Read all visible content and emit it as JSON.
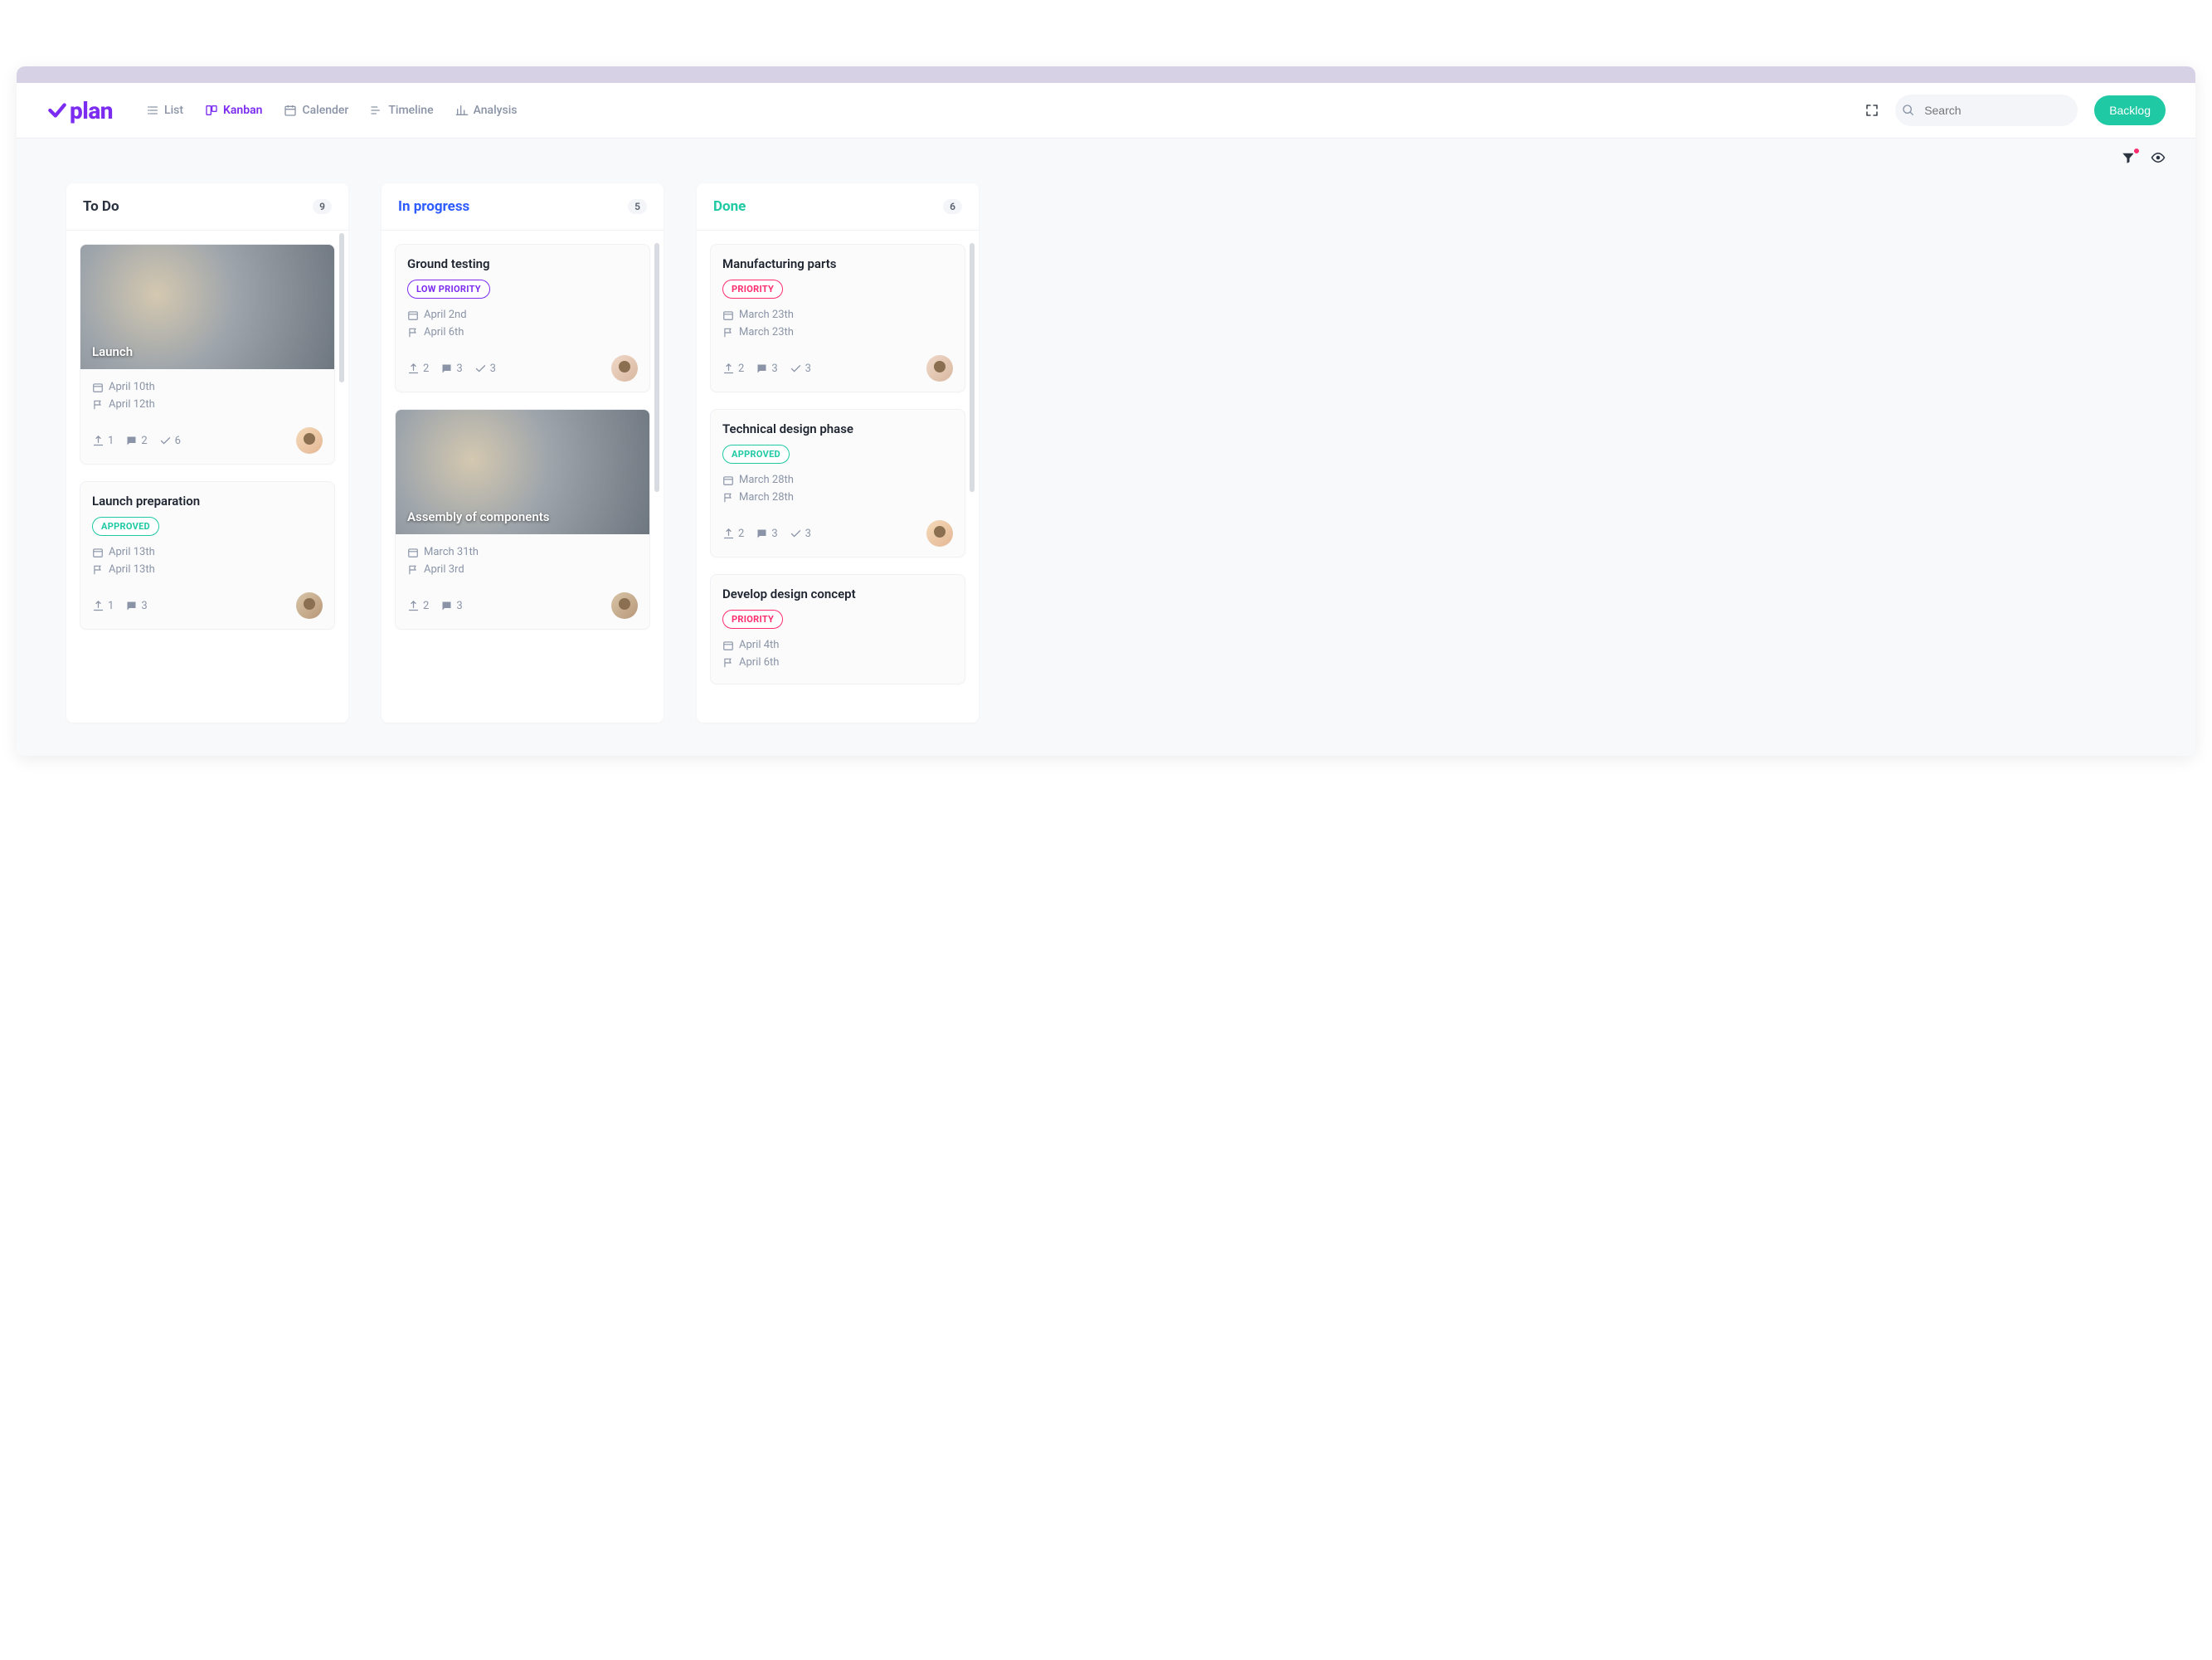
{
  "brand": {
    "name": "plan"
  },
  "nav": {
    "list": "List",
    "kanban": "Kanban",
    "calendar": "Calender",
    "timeline": "Timeline",
    "analysis": "Analysis"
  },
  "search": {
    "placeholder": "Search"
  },
  "backlog_btn": "Backlog",
  "columns": {
    "todo": {
      "title": "To Do",
      "count": "9"
    },
    "inprogress": {
      "title": "In progress",
      "count": "5"
    },
    "done": {
      "title": "Done",
      "count": "6"
    }
  },
  "tags": {
    "approved": "APPROVED",
    "low_priority": "LOW PRIORITY",
    "priority": "PRIORITY"
  },
  "cards": {
    "launch": {
      "title": "Launch",
      "start": "April 10th",
      "end": "April 12th",
      "attach": "1",
      "comments": "2",
      "checks": "6"
    },
    "launch_prep": {
      "title": "Launch preparation",
      "start": "April 13th",
      "end": "April 13th",
      "attach": "1",
      "comments": "3"
    },
    "ground": {
      "title": "Ground testing",
      "start": "April 2nd",
      "end": "April 6th",
      "attach": "2",
      "comments": "3",
      "checks": "3"
    },
    "assembly": {
      "title": "Assembly of components",
      "start": "March 31th",
      "end": "April 3rd",
      "attach": "2",
      "comments": "3"
    },
    "manufacturing": {
      "title": "Manufacturing parts",
      "start": "March 23th",
      "end": "March 23th",
      "attach": "2",
      "comments": "3",
      "checks": "3"
    },
    "technical": {
      "title": "Technical design phase",
      "start": "March 28th",
      "end": "March 28th",
      "attach": "2",
      "comments": "3",
      "checks": "3"
    },
    "concept": {
      "title": "Develop design concept",
      "start": "April 4th",
      "end": "April 6th"
    }
  }
}
